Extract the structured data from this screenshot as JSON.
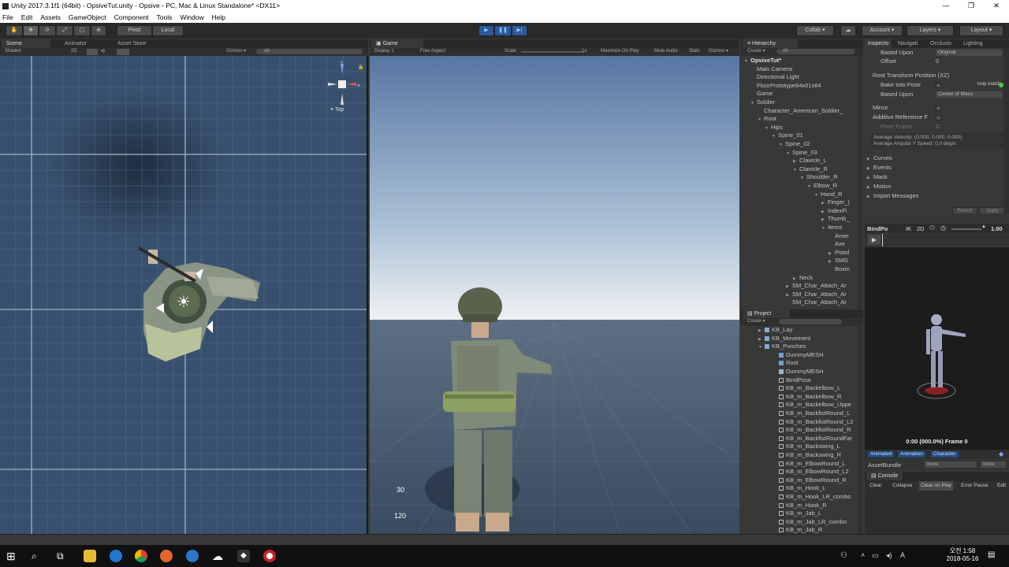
{
  "window": {
    "title": "Unity 2017.3.1f1 (64bit) - OpsiveTut.unity - Opsive - PC, Mac & Linux Standalone* <DX11>",
    "controls": [
      "—",
      "❐",
      "✕"
    ]
  },
  "menu": [
    "File",
    "Edit",
    "Assets",
    "GameObject",
    "Component",
    "Tools",
    "Window",
    "Help"
  ],
  "toolbar": {
    "pivot": "Pivot",
    "local": "Local",
    "collab": "Collab ▾",
    "account": "Account ▾",
    "layers": "Layers ▾",
    "layout": "Layout ▾"
  },
  "scene": {
    "tabs": [
      "Scene",
      "Animator",
      "Asset Store"
    ],
    "shading": "Shaded",
    "mode2d": "2D",
    "gizmos": "Gizmos ▾",
    "search": "All",
    "gizmo_label": "Top"
  },
  "game": {
    "tab": "Game",
    "display": "Display 1",
    "aspect": "Free Aspect",
    "scale_label": "Scale",
    "scale_value": "1x",
    "maximize": "Maximize On Play",
    "mute": "Mute Audio",
    "stats": "Stats",
    "gizmos": "Gizmos ▾",
    "stat_top": "30",
    "stat_bottom": "120"
  },
  "hierarchy": {
    "tab": "Hierarchy",
    "create": "Create ▾",
    "search": "All",
    "scene_name": "OpsiveTut*",
    "items": [
      {
        "label": "Main Camera",
        "indent": 0,
        "tri": ""
      },
      {
        "label": "Directional Light",
        "indent": 0,
        "tri": ""
      },
      {
        "label": "FloorPrototype64x01x64",
        "indent": 0,
        "tri": ""
      },
      {
        "label": "Game",
        "indent": 0,
        "tri": ""
      },
      {
        "label": "Soldier",
        "indent": 0,
        "tri": "▼"
      },
      {
        "label": "Character_American_Soldier_",
        "indent": 1,
        "tri": ""
      },
      {
        "label": "Root",
        "indent": 1,
        "tri": "▼"
      },
      {
        "label": "Hips",
        "indent": 2,
        "tri": "▼"
      },
      {
        "label": "Spine_01",
        "indent": 3,
        "tri": "▼"
      },
      {
        "label": "Spine_02",
        "indent": 4,
        "tri": "▼"
      },
      {
        "label": "Spine_03",
        "indent": 5,
        "tri": "▼"
      },
      {
        "label": "Clavicle_L",
        "indent": 6,
        "tri": "▶"
      },
      {
        "label": "Clavicle_R",
        "indent": 6,
        "tri": "▼"
      },
      {
        "label": "Shoulder_R",
        "indent": 7,
        "tri": "▼"
      },
      {
        "label": "Elbow_R",
        "indent": 8,
        "tri": "▼"
      },
      {
        "label": "Hand_R",
        "indent": 9,
        "tri": "▼"
      },
      {
        "label": "Finger_(",
        "indent": 10,
        "tri": "▶"
      },
      {
        "label": "IndexFi",
        "indent": 10,
        "tri": "▶"
      },
      {
        "label": "Thumb_",
        "indent": 10,
        "tri": "▶"
      },
      {
        "label": "Items",
        "indent": 10,
        "tri": "▼"
      },
      {
        "label": "Amer",
        "indent": 11,
        "tri": ""
      },
      {
        "label": "Axe",
        "indent": 11,
        "tri": ""
      },
      {
        "label": "Pistol",
        "indent": 11,
        "tri": "▶"
      },
      {
        "label": "SMG",
        "indent": 11,
        "tri": "▶"
      },
      {
        "label": "Boxin",
        "indent": 11,
        "tri": ""
      },
      {
        "label": "Neck",
        "indent": 6,
        "tri": "▶"
      },
      {
        "label": "SM_Char_Attach_Ar",
        "indent": 5,
        "tri": "▶"
      },
      {
        "label": "SM_Char_Attach_Ar",
        "indent": 5,
        "tri": "▶"
      },
      {
        "label": "SM_Char_Attach_Ar",
        "indent": 5,
        "tri": ""
      }
    ]
  },
  "project": {
    "tab": "Project",
    "create": "Create ▾",
    "items": [
      {
        "label": "KB_Lay",
        "indent": 2,
        "tri": "▶",
        "icon": "folder"
      },
      {
        "label": "KB_Movement",
        "indent": 2,
        "tri": "▶",
        "icon": "folder"
      },
      {
        "label": "KB_Punches",
        "indent": 2,
        "tri": "▼",
        "icon": "folder"
      },
      {
        "label": "DummyMESH",
        "indent": 4,
        "tri": "",
        "icon": "cube"
      },
      {
        "label": "Root",
        "indent": 4,
        "tri": "",
        "icon": "cube"
      },
      {
        "label": "DummyMESH",
        "indent": 4,
        "tri": "",
        "icon": "grid"
      },
      {
        "label": "BindPose",
        "indent": 4,
        "tri": "",
        "icon": "anim"
      },
      {
        "label": "KB_m_Backelbow_L",
        "indent": 4,
        "tri": "",
        "icon": "anim"
      },
      {
        "label": "KB_m_Backelbow_R",
        "indent": 4,
        "tri": "",
        "icon": "anim"
      },
      {
        "label": "KB_m_Backelbow_Uppe",
        "indent": 4,
        "tri": "",
        "icon": "anim"
      },
      {
        "label": "KB_m_BackfistRound_L",
        "indent": 4,
        "tri": "",
        "icon": "anim"
      },
      {
        "label": "KB_m_BackfistRound_L2",
        "indent": 4,
        "tri": "",
        "icon": "anim"
      },
      {
        "label": "KB_m_BackfistRound_R",
        "indent": 4,
        "tri": "",
        "icon": "anim"
      },
      {
        "label": "KB_m_BackfistRoundFar",
        "indent": 4,
        "tri": "",
        "icon": "anim"
      },
      {
        "label": "KB_m_Backswing_L",
        "indent": 4,
        "tri": "",
        "icon": "anim"
      },
      {
        "label": "KB_m_Backswing_R",
        "indent": 4,
        "tri": "",
        "icon": "anim"
      },
      {
        "label": "KB_m_ElbowRound_L",
        "indent": 4,
        "tri": "",
        "icon": "anim"
      },
      {
        "label": "KB_m_ElbowRound_L2",
        "indent": 4,
        "tri": "",
        "icon": "anim"
      },
      {
        "label": "KB_m_ElbowRound_R",
        "indent": 4,
        "tri": "",
        "icon": "anim"
      },
      {
        "label": "KB_m_Hook_L",
        "indent": 4,
        "tri": "",
        "icon": "anim"
      },
      {
        "label": "KB_m_Hook_LR_combo",
        "indent": 4,
        "tri": "",
        "icon": "anim"
      },
      {
        "label": "KB_m_Hook_R",
        "indent": 4,
        "tri": "",
        "icon": "anim"
      },
      {
        "label": "KB_m_Jab_L",
        "indent": 4,
        "tri": "",
        "icon": "anim"
      },
      {
        "label": "KB_m_Jab_LR_combo",
        "indent": 4,
        "tri": "",
        "icon": "anim"
      },
      {
        "label": "KB_m_Jab_R",
        "indent": 4,
        "tri": "",
        "icon": "anim"
      }
    ]
  },
  "inspector": {
    "tabs": [
      "Inspecto",
      "Navigati",
      "Occlusio",
      "Lighting"
    ],
    "based_upon_top_label": "Based Upon",
    "based_upon_top_value": "Original",
    "offset_label": "Offset",
    "offset_value": "0",
    "root_pos_header": "Root Transform Position (XZ)",
    "bake_label": "Bake Into Pose",
    "loop_match": "loop match",
    "based_upon_label": "Based Upon",
    "based_upon_value": "Center of Mass",
    "mirror_label": "Mirror",
    "additive_label": "Additive Reference F",
    "pose_frame_label": "Pose Frame",
    "pose_frame_value": "0",
    "avg_velocity": "Average Velocity: (0.000, 0.000, 0.000)",
    "avg_angular": "Average Angular Y Speed: 0.0 deg/s",
    "sections": [
      "Curves",
      "Events",
      "Mask",
      "Motion",
      "Import Messages"
    ],
    "revert": "Revert",
    "apply": "Apply",
    "preview_name": "BindPo",
    "preview_ik": "IK",
    "preview_2d": "2D",
    "preview_speed": "1.00",
    "preview_time": "0:00 (000.0%) Frame 0",
    "labels": [
      "Animated",
      "Animation",
      "Character"
    ],
    "assetbundle_label": "AssetBundle",
    "assetbundle_value": "None",
    "assetbundle_variant": "None",
    "console_tab": "Console",
    "console_buttons": [
      "Clear",
      "Collapse",
      "Clear on Play",
      "Error Pause",
      "Edit"
    ]
  },
  "taskbar": {
    "time": "오전 1:58",
    "date": "2018-05-16"
  }
}
